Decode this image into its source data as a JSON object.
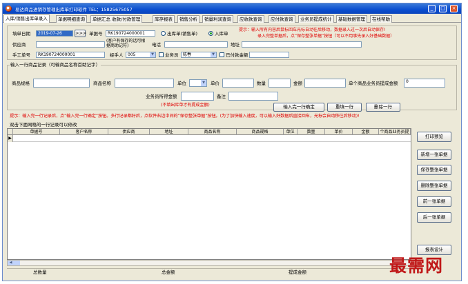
{
  "window": {
    "title": "易达商品进销存管理出库单打印软件   TEL：15825675057",
    "buttons": [
      "_",
      "□",
      "×"
    ]
  },
  "tabs": [
    {
      "label": "入库/销售出库单录入",
      "active": true
    },
    {
      "label": "单据明细查询"
    },
    {
      "label": "单据汇总 收款/付款管理"
    },
    {
      "label": "库存报表"
    },
    {
      "label": "销售分析"
    },
    {
      "label": "销量利润查询"
    },
    {
      "label": "应收款查询"
    },
    {
      "label": "应付款查询"
    },
    {
      "label": "业务员提成统计"
    },
    {
      "label": "基础数据管理"
    },
    {
      "label": "在线帮助"
    }
  ],
  "form": {
    "date_label": "填单日期",
    "date_value": "2019-07-26",
    "ellipsis_button": ">>>",
    "order_no_label": "单据号",
    "order_no_value": "RK190724000001",
    "out_radio_label": "出库单(销售单)",
    "in_radio_label": "入库单",
    "tip_line1": "提示：输入所有内容后鼠标回车光标自动往后移动，数据录入过一次后自动保存!",
    "tip_line2": "录入完整单据后，点“保存整张单据”按钮（可以不用事先录入好基础数据）",
    "supplier_label": "供应商",
    "supplier_value": "",
    "customer_note": "(客户有保存的话可根据商助记符)",
    "phone_label": "电话",
    "phone_value": "",
    "address_label": "地址",
    "address_value": "",
    "manual_no_label": "手工单号",
    "manual_no_value": "RK190724000001",
    "handler_label": "经手人",
    "handler_value": "005",
    "salesperson_label": "业务员",
    "salesperson_value": "陈春",
    "paid_label": "已付款金额",
    "paid_value": ""
  },
  "item_section": {
    "title": "输入一行商品记录（可输商品名称首助记字）",
    "spec_label": "商品规格",
    "name_label": "商品名称",
    "unit_label": "单位",
    "price_label": "单价",
    "qty_label": "数量",
    "amount_label": "金额",
    "commission_label": "单个商品业务员提成金额",
    "commission_value": "0",
    "salesperson_amount_label": "业务员所得金额",
    "remark_label": "备注",
    "note": "(不填出库单才有提成金额)",
    "btn_confirm": "输入完一行确定",
    "btn_reset": "重填一行",
    "btn_delete": "删除一行"
  },
  "tip2": "提示：输入完一行记录后，点“输入完一行确定”按钮。多行记录都好后，点软件右边中间的“保存整张单据”按钮。(为了加快输入速度，可以输入好数据后直接回车，光标会自动移往后移动)!",
  "grid": {
    "caption": "双击下面网格的一行记录可以修改",
    "columns": [
      "单据号",
      "客户名称",
      "供应商",
      "地址",
      "商品名称",
      "商品规格",
      "单位",
      "数量",
      "单价",
      "金额",
      "个商品业务员提"
    ],
    "current_row_marker": "▶"
  },
  "side_buttons": [
    "打印预览",
    "新增一张单据",
    "保存整张单据",
    "删除整张单据",
    "前一张单据",
    "后一张单据",
    "报表设计"
  ],
  "footer": {
    "total_qty_label": "总数量",
    "total_amount_label": "总金额",
    "commission_total_label": "提成金额"
  },
  "watermark": "最需网",
  "colors": {
    "titlebar": "#0a4ed0",
    "tip_text": "#e00000",
    "date_selected": "#316ac5",
    "watermark": "#c01818"
  }
}
